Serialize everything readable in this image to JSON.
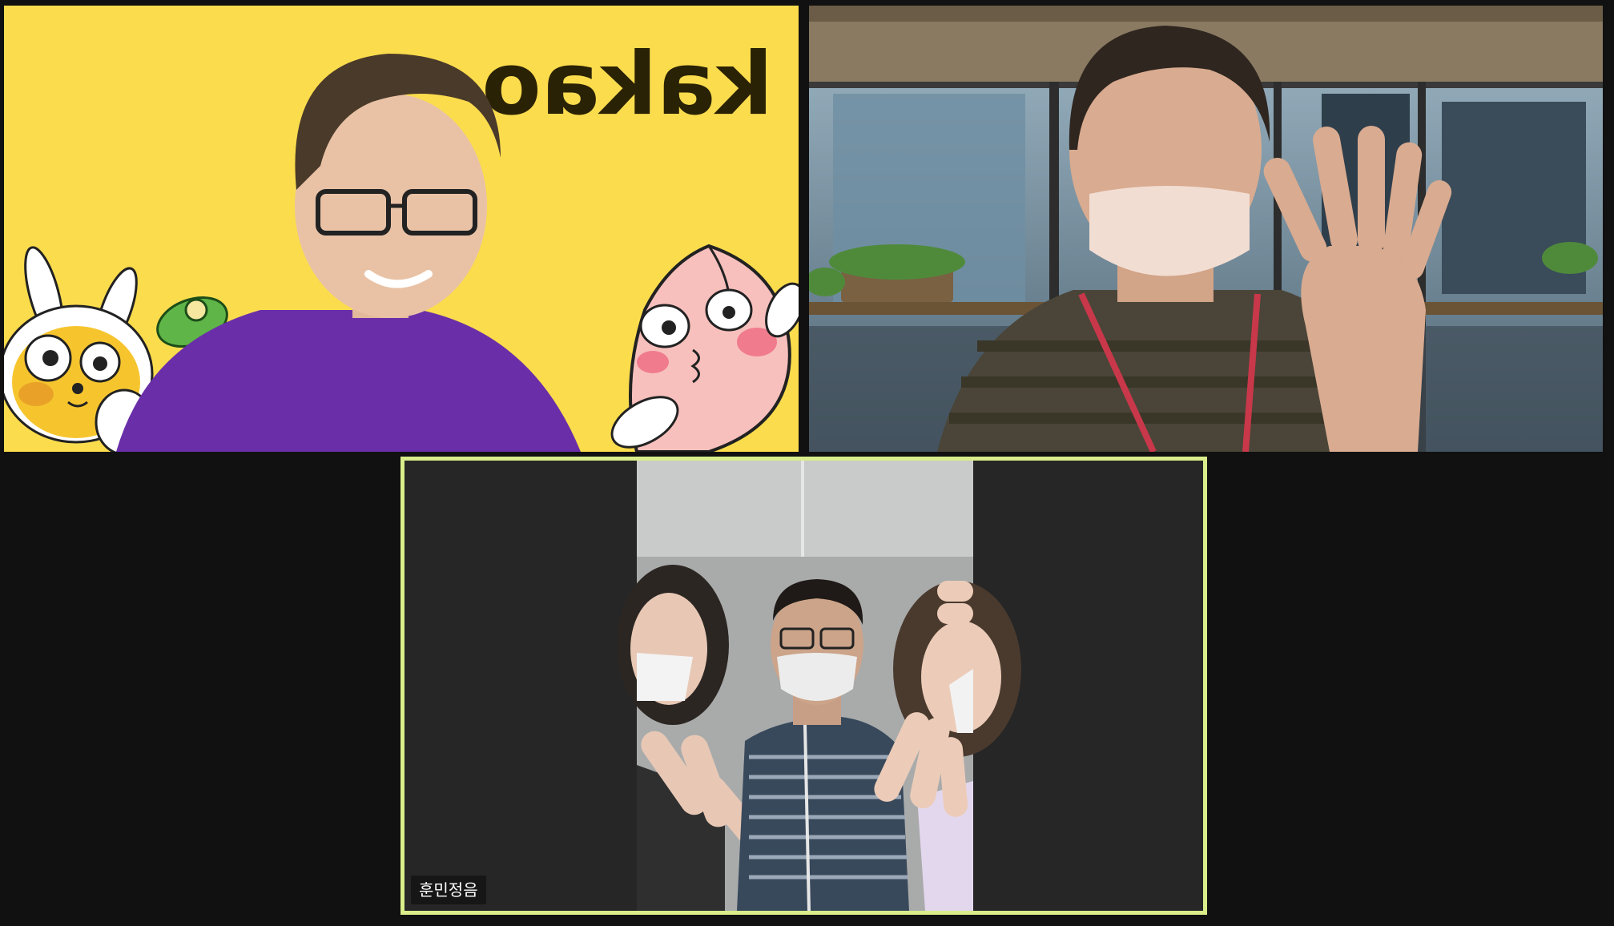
{
  "meeting": {
    "view": "gallery",
    "participants": [
      {
        "id": "p1",
        "name": "",
        "background_brand": "kakao",
        "video": "on"
      },
      {
        "id": "p2",
        "name": "",
        "video": "on"
      },
      {
        "id": "p3",
        "name": "훈민정음",
        "video": "on",
        "active_speaker": true
      }
    ]
  },
  "colors": {
    "stage_bg": "#111111",
    "kakao_yellow": "#fbdc4d",
    "active_speaker_border": "#d9ee8a",
    "name_label_bg": "#141414"
  },
  "icons": [
    "rabbit-character-icon",
    "peach-character-icon",
    "frog-hand-icon"
  ]
}
